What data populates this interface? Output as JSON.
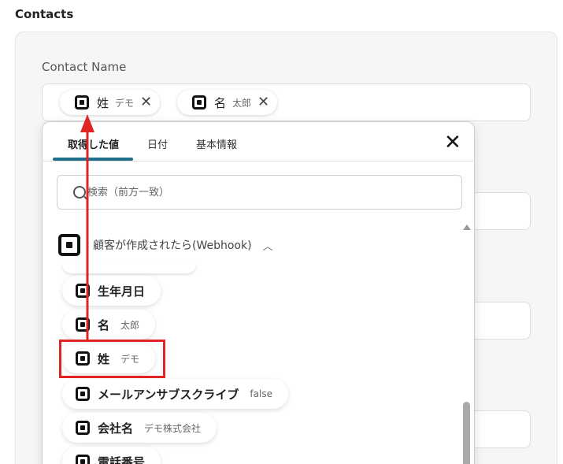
{
  "section": {
    "title": "Contacts"
  },
  "field": {
    "label": "Contact Name"
  },
  "selected_chips": [
    {
      "name": "姓",
      "value": "デモ"
    },
    {
      "name": "名",
      "value": "太郎"
    }
  ],
  "dropdown": {
    "tabs": [
      {
        "label": "取得した値",
        "active": true
      },
      {
        "label": "日付",
        "active": false
      },
      {
        "label": "基本情報",
        "active": false
      }
    ],
    "search_placeholder": "検索（前方一致）",
    "group_title": "顧客が作成されたら(Webhook)",
    "items": [
      {
        "name": "生年月日",
        "value": ""
      },
      {
        "name": "名",
        "value": "太郎"
      },
      {
        "name": "姓",
        "value": "デモ"
      },
      {
        "name": "メールアンサブスクライブ",
        "value": "false"
      },
      {
        "name": "会社名",
        "value": "デモ株式会社"
      },
      {
        "name": "電話番号",
        "value": ""
      }
    ]
  },
  "annotation_color": "#e02424",
  "accent_color": "#1f6f8b"
}
